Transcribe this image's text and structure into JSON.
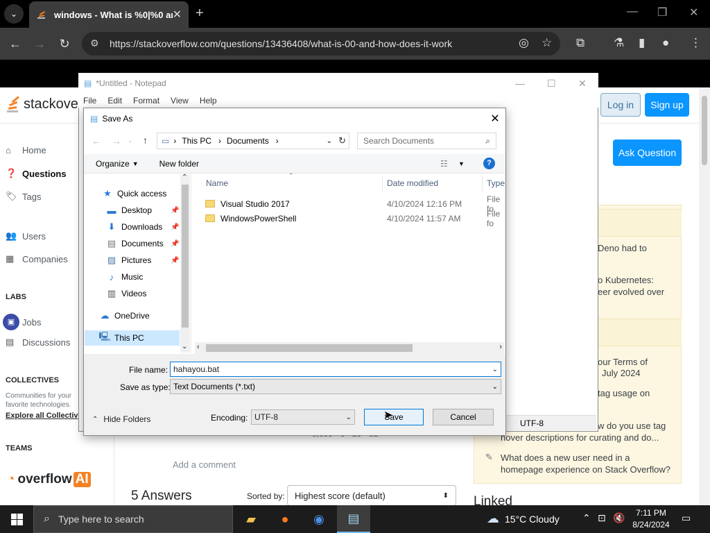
{
  "browser": {
    "tab_title": "windows - What is %0|%0 and",
    "tab_close": "✕",
    "new_tab": "+",
    "url": "https://stackoverflow.com/questions/13436408/what-is-00-and-how-does-it-work"
  },
  "so": {
    "logo_text": "stackover",
    "login": "Log in",
    "signup": "Sign up",
    "ask": "Ask Question",
    "nav": {
      "home": "Home",
      "questions": "Questions",
      "tags": "Tags",
      "users": "Users",
      "companies": "Companies",
      "labs_head": "LABS",
      "jobs": "Jobs",
      "discussions": "Discussions",
      "collectives_head": "COLLECTIVES",
      "collectives_text1": "Communities for your",
      "collectives_text2": "favorite technologies.",
      "explore": "Explore all Collectiv",
      "teams_head": "TEAMS",
      "overflow_ai": "overflow",
      "ai": "AI"
    },
    "blog": {
      "item1_l1": "Deno had to",
      "item2_l1": "o Kubernetes:",
      "item2_l2": "eer evolved over",
      "item3_l1": "our Terms of",
      "item3_l2": "July 2024",
      "item4_l1": "tag usage on",
      "item5_l1": "w do you use tag",
      "item5_l2": "hover descriptions for curating and do...",
      "item6_l1": "What does a new user need in a",
      "item6_l2": "homepage experience on Stack Overflow?"
    },
    "add_comment": "Add a comment",
    "answers": "5 Answers",
    "sorted_by": "Sorted by:",
    "sort_value": "Highest score (default)",
    "linked": "Linked",
    "user_strip": "3,655 · 3 · 25 · 32"
  },
  "notepad": {
    "title": "*Untitled - Notepad",
    "menu": [
      "File",
      "Edit",
      "Format",
      "View",
      "Help"
    ],
    "encoding_status": "UTF-8"
  },
  "dialog": {
    "title": "Save As",
    "breadcrumb": [
      "This PC",
      "Documents"
    ],
    "search_placeholder": "Search Documents",
    "organize": "Organize",
    "new_folder": "New folder",
    "nav_items": [
      {
        "label": "Quick access",
        "icon": "star-icon"
      },
      {
        "label": "Desktop",
        "icon": "desktop-icon"
      },
      {
        "label": "Downloads",
        "icon": "download-icon"
      },
      {
        "label": "Documents",
        "icon": "document-icon"
      },
      {
        "label": "Pictures",
        "icon": "pictures-icon"
      },
      {
        "label": "Music",
        "icon": "music-icon"
      },
      {
        "label": "Videos",
        "icon": "videos-icon"
      },
      {
        "label": "OneDrive",
        "icon": "cloud-icon"
      },
      {
        "label": "This PC",
        "icon": "computer-icon"
      }
    ],
    "columns": {
      "name": "Name",
      "date": "Date modified",
      "type": "Type"
    },
    "files": [
      {
        "name": "Visual Studio 2017",
        "date": "4/10/2024 12:16 PM",
        "type": "File fo"
      },
      {
        "name": "WindowsPowerShell",
        "date": "4/10/2024 11:57 AM",
        "type": "File fo"
      }
    ],
    "file_name_label": "File name:",
    "file_name_value": "hahayou.bat",
    "save_type_label": "Save as type:",
    "save_type_value": "Text Documents (*.txt)",
    "hide_folders": "Hide Folders",
    "encoding_label": "Encoding:",
    "encoding_value": "UTF-8",
    "save": "Save",
    "cancel": "Cancel"
  },
  "taskbar": {
    "search_placeholder": "Type here to search",
    "weather": "15°C  Cloudy",
    "time": "7:11 PM",
    "date": "8/24/2024"
  },
  "colors": {
    "so_orange": "#f48225",
    "so_blue": "#0a95ff",
    "win_accent": "#0078d7"
  }
}
